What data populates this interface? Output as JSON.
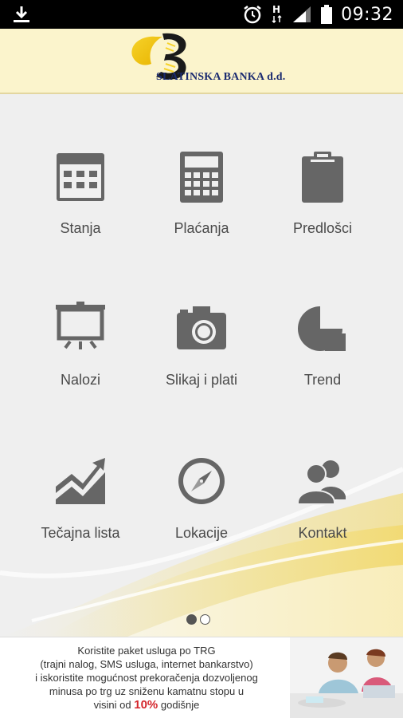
{
  "status_bar": {
    "time": "09:32"
  },
  "header": {
    "bank_name": "SLATINSKA BANKA d.d."
  },
  "menu": [
    {
      "label": "Stanja",
      "icon": "calendar-icon"
    },
    {
      "label": "Plaćanja",
      "icon": "calculator-icon"
    },
    {
      "label": "Predlošci",
      "icon": "clipboard-icon"
    },
    {
      "label": "Nalozi",
      "icon": "presentation-board-icon"
    },
    {
      "label": "Slikaj i plati",
      "icon": "camera-icon"
    },
    {
      "label": "Trend",
      "icon": "pie-chart-icon"
    },
    {
      "label": "Tečajna lista",
      "icon": "trend-chart-icon"
    },
    {
      "label": "Lokacije",
      "icon": "compass-icon"
    },
    {
      "label": "Kontakt",
      "icon": "contacts-icon"
    }
  ],
  "pager": {
    "pages": 2,
    "current": 1
  },
  "banner": {
    "line1": "Koristite paket usluga po TRG",
    "line2": "(trajni nalog, SMS usluga, internet bankarstvo)",
    "line3": "i iskoristite mogućnost prekoračenja dozvoljenog",
    "line4": "minusa po trg uz sniženu kamatnu stopu u",
    "line5_pre": "visini od",
    "line5_pct": "10%",
    "line5_post": "godišnje"
  }
}
